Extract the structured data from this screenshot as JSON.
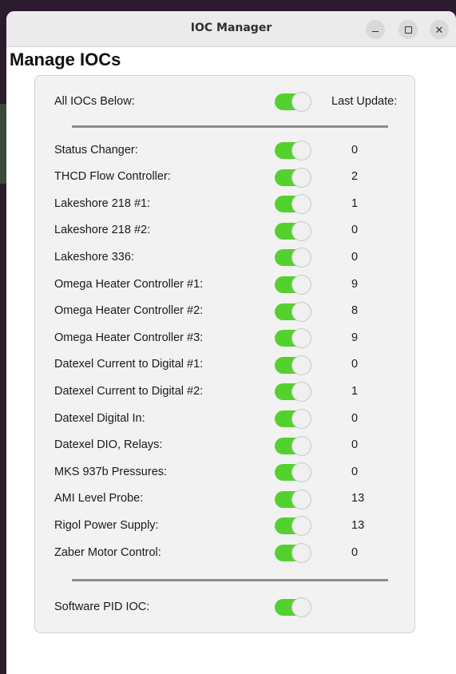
{
  "window": {
    "title": "IOC Manager",
    "minimize_icon": "minimize-icon",
    "maximize_icon": "maximize-icon",
    "close_icon": "close-icon",
    "close_glyph": "✕"
  },
  "page": {
    "heading": "Manage IOCs"
  },
  "colors": {
    "toggle_on": "#53d12f",
    "panel_bg": "#f2f2f2",
    "separator": "#8d8d8d",
    "titlebar_bg": "#ebebeb"
  },
  "header_row": {
    "label": "All IOCs Below:",
    "toggle_on": true,
    "last_update_label": "Last Update:"
  },
  "iocs": [
    {
      "label": "Status Changer:",
      "value": "0",
      "toggle_on": true
    },
    {
      "label": "THCD Flow Controller:",
      "value": "2",
      "toggle_on": true
    },
    {
      "label": "Lakeshore 218 #1:",
      "value": "1",
      "toggle_on": true
    },
    {
      "label": "Lakeshore 218 #2:",
      "value": "0",
      "toggle_on": true
    },
    {
      "label": "Lakeshore 336:",
      "value": "0",
      "toggle_on": true
    },
    {
      "label": "Omega Heater Controller #1:",
      "value": "9",
      "toggle_on": true
    },
    {
      "label": "Omega Heater Controller #2:",
      "value": "8",
      "toggle_on": true
    },
    {
      "label": "Omega Heater Controller #3:",
      "value": "9",
      "toggle_on": true
    },
    {
      "label": "Datexel Current to Digital #1:",
      "value": "0",
      "toggle_on": true
    },
    {
      "label": "Datexel Current to Digital #2:",
      "value": "1",
      "toggle_on": true
    },
    {
      "label": "Datexel Digital In:",
      "value": "0",
      "toggle_on": true
    },
    {
      "label": "Datexel DIO, Relays:",
      "value": "0",
      "toggle_on": true
    },
    {
      "label": "MKS 937b Pressures:",
      "value": "0",
      "toggle_on": true
    },
    {
      "label": "AMI Level Probe:",
      "value": "13",
      "toggle_on": true
    },
    {
      "label": "Rigol Power Supply:",
      "value": "13",
      "toggle_on": true
    },
    {
      "label": "Zaber Motor Control:",
      "value": "0",
      "toggle_on": true
    }
  ],
  "footer_row": {
    "label": "Software PID IOC:",
    "toggle_on": true
  }
}
